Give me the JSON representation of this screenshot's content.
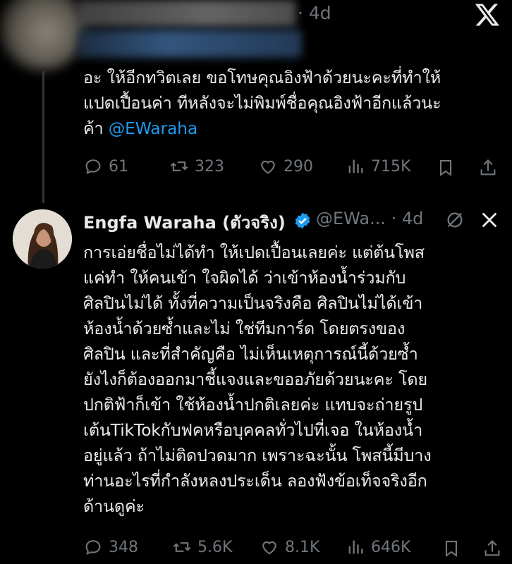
{
  "tweet1": {
    "time": "· 4d",
    "text": "อะ ให้อีกทวิตเลย ขอโทษคุณอิงฟ้าด้วยนะคะที่ทำให้\nแปดเปื้อนค่า ทีหลังจะไม่พิมพ์ชื่อคุณอิงฟ้าอีกแล้วนะ\nค้า ",
    "mention": "@EWaraha",
    "stats": {
      "replies": "61",
      "reposts": "323",
      "likes": "290",
      "views": "715K"
    }
  },
  "tweet2": {
    "name": "Engfa Waraha (ตัวจริง)",
    "handle": "@EWa...",
    "time": "· 4d",
    "text": "การเอ่ยชื่อไม่ได้ทำ ให้เปดเปื้อนเลยค่ะ แต่ต้นโพส\nแค่ทำ ให้คนเข้า ใจผิดได้ ว่าเข้าห้องน้ำร่วมกับ\nศิลปินไม่ได้ ทั้งที่ความเป็นจริงคือ ศิลปินไม่ได้เข้า\nห้องน้ำด้วยซ้ำและไม่ ใช่ทีมการ์ด โดยตรงของ\nศิลปิน และที่สำคัญคือ ไม่เห็นเหตุการณ์นี้ด้วยซ้ำ\nยังไงก็ต้องออกมาชี้แจงและขออภัยด้วยนะคะ โดย\nปกติฟ้าก็เข้า ใช้ห้องน้ำปกติเลยค่ะ แทบจะถ่ายรูป\nเต้นTikTokกับฟคหรือบุคคลทั่วไปที่เจอ ในห้องน้ำ\nอยู่แล้ว ถ้าไม่ติดปวดมาก เพราะฉะนั้น โพสนี้มีบาง\nท่านอะไรที่กำลังหลงประเด็น ลองฟังข้อเท็จจริงอีก\nด้านดูค่ะ",
    "stats": {
      "replies": "348",
      "reposts": "5.6K",
      "likes": "8.1K",
      "views": "646K"
    }
  },
  "colors": {
    "background": "#000000",
    "text": "#e7e9ea",
    "muted": "#71767b",
    "accent": "#1d9bf0"
  },
  "icons": [
    "x-logo-icon",
    "reply-icon",
    "repost-icon",
    "like-icon",
    "views-icon",
    "bookmark-icon",
    "share-icon",
    "verified-icon",
    "grok-icon",
    "more-icon"
  ]
}
